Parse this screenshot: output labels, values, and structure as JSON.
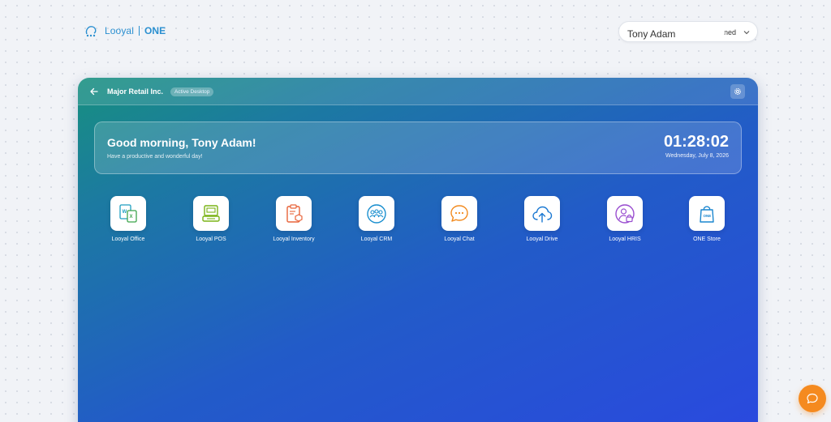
{
  "brand": {
    "logo_name": "Looyal",
    "logo_suffix": "ONE",
    "color": "#2a8fd0"
  },
  "user": {
    "name": "Tony Adam",
    "status": "ned"
  },
  "desktop": {
    "company": "Major Retail Inc.",
    "badge": "Active Desktop",
    "gradient_start": "#17907f",
    "gradient_end": "#2a49df"
  },
  "greeting": {
    "title": "Good morning, Tony Adam!",
    "subtitle": "Have a productive and wonderful day!",
    "time": "01:28:02",
    "date": "Wednesday, July 8, 2026"
  },
  "apps": [
    {
      "label": "Looyal Office",
      "icon": "office-docs-icon",
      "color": "#1d9ec0"
    },
    {
      "label": "Looyal POS",
      "icon": "pos-terminal-icon",
      "color": "#7ab317"
    },
    {
      "label": "Looyal Inventory",
      "icon": "inventory-clipboard-icon",
      "color": "#e8643a"
    },
    {
      "label": "Looyal CRM",
      "icon": "crm-people-icon",
      "color": "#1a8fcf"
    },
    {
      "label": "Looyal Chat",
      "icon": "chat-bubble-icon",
      "color": "#f28a1e"
    },
    {
      "label": "Looyal Drive",
      "icon": "cloud-upload-icon",
      "color": "#1a78d2"
    },
    {
      "label": "Looyal HRIS",
      "icon": "hris-user-lock-icon",
      "color": "#9a4fd0"
    },
    {
      "label": "ONE Store",
      "icon": "store-bag-icon",
      "color": "#1a86cf"
    }
  ],
  "chat_fab": {
    "icon": "chat-bubble-icon",
    "color": "#f58a1f"
  }
}
